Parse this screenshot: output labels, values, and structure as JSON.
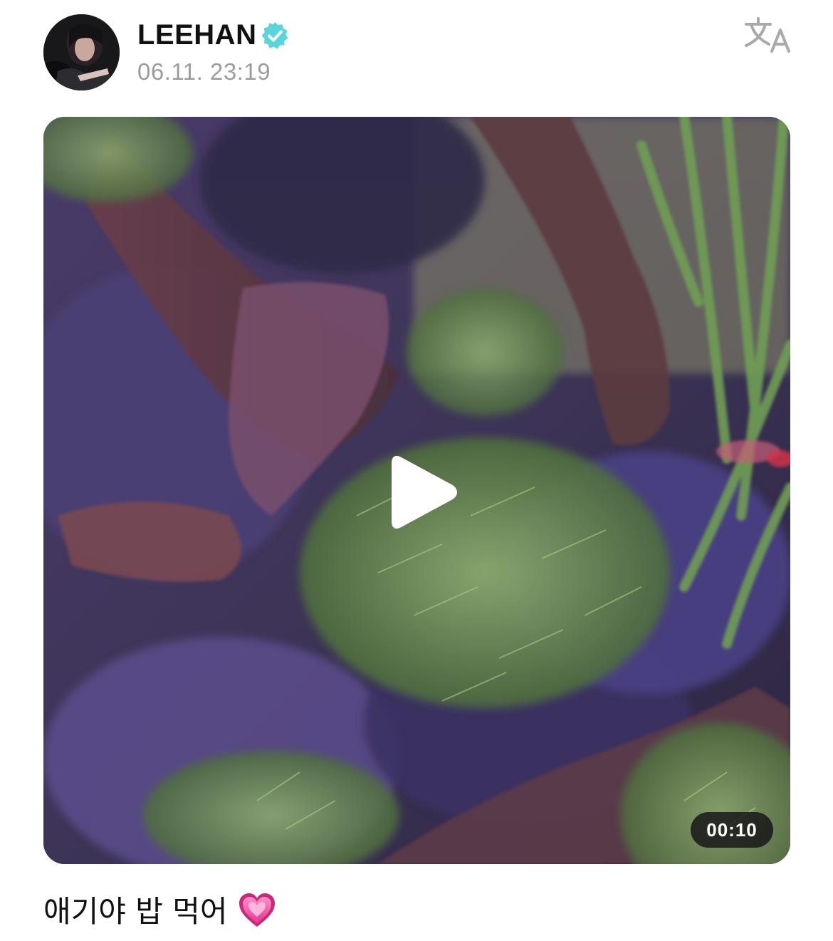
{
  "author": {
    "name": "LEEHAN",
    "verified_icon": "verified-badge-icon",
    "verified_color": "#56d9dc",
    "avatar_icon": "profile-photo"
  },
  "post": {
    "timestamp": "06.11. 23:19",
    "caption": "애기야 밥 먹어",
    "caption_emoji": "heart-emoji"
  },
  "media": {
    "type": "video",
    "duration": "00:10",
    "play_icon": "play-icon"
  },
  "toolbar": {
    "translate_icon": "translate-icon"
  }
}
